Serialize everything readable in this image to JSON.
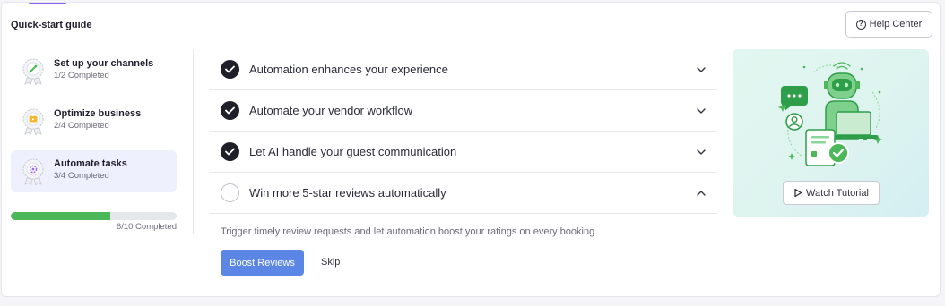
{
  "guide": {
    "title": "Quick-start guide",
    "help_label": "Help Center"
  },
  "steps": [
    {
      "title": "Set up your channels",
      "subtitle": "1/2 Completed",
      "icon": "channels-medal-icon",
      "active": false
    },
    {
      "title": "Optimize business",
      "subtitle": "2/4 Completed",
      "icon": "business-medal-icon",
      "active": false
    },
    {
      "title": "Automate tasks",
      "subtitle": "3/4 Completed",
      "icon": "automation-medal-icon",
      "active": true
    }
  ],
  "progress": {
    "completed": 6,
    "total": 10,
    "label": "6/10 Completed",
    "color": "#4cb85a"
  },
  "tasks": [
    {
      "label": "Automation enhances your experience",
      "done": true,
      "expanded": false
    },
    {
      "label": "Automate your vendor workflow",
      "done": true,
      "expanded": false
    },
    {
      "label": "Let AI handle your guest communication",
      "done": true,
      "expanded": false
    },
    {
      "label": "Win more 5-star reviews automatically",
      "done": false,
      "expanded": true
    }
  ],
  "expanded_task": {
    "description": "Trigger timely review requests and let automation boost your ratings on every booking.",
    "primary_label": "Boost Reviews",
    "secondary_label": "Skip"
  },
  "illustration": {
    "watch_label": "Watch Tutorial"
  },
  "colors": {
    "primary": "#5b86e5",
    "accent": "#8b5cf6",
    "success": "#4cb85a"
  }
}
